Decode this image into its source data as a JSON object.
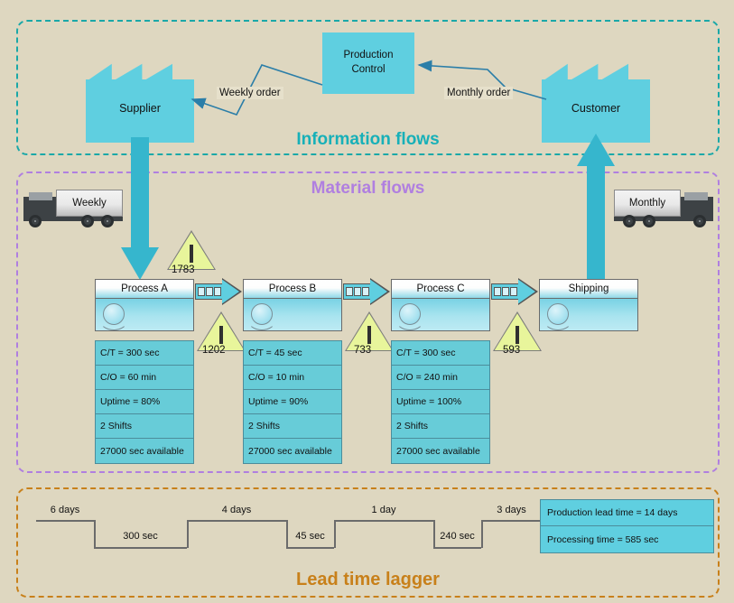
{
  "bands": {
    "information": {
      "title": "Information flows",
      "color": "#17b0b8"
    },
    "material": {
      "title": "Material flows",
      "color": "#b07fe0"
    },
    "ladder": {
      "title": "Lead time lagger",
      "color": "#c8801a"
    }
  },
  "information": {
    "supplier_label": "Supplier",
    "customer_label": "Customer",
    "production_control_label": "Production\nControl",
    "production_control_line1": "Production",
    "production_control_line2": "Control",
    "weekly_order_label": "Weekly order",
    "monthly_order_label": "Monthly order"
  },
  "material": {
    "inbound_truck_label": "Weekly",
    "outbound_truck_label": "Monthly",
    "processes": [
      {
        "name": "Process A",
        "metrics": [
          "C/T = 300 sec",
          "C/O = 60 min",
          "Uptime = 80%",
          "2 Shifts",
          "27000 sec available"
        ]
      },
      {
        "name": "Process B",
        "metrics": [
          "C/T = 45 sec",
          "C/O = 10 min",
          "Uptime = 90%",
          "2 Shifts",
          "27000 sec available"
        ]
      },
      {
        "name": "Process C",
        "metrics": [
          "C/T = 300 sec",
          "C/O = 240 min",
          "Uptime = 100%",
          "2 Shifts",
          "27000 sec available"
        ]
      },
      {
        "name": "Shipping",
        "metrics": []
      }
    ],
    "inventories": [
      {
        "symbol": "I",
        "count": "1783"
      },
      {
        "symbol": "I",
        "count": "1202"
      },
      {
        "symbol": "I",
        "count": "733"
      },
      {
        "symbol": "I",
        "count": "593"
      }
    ]
  },
  "ladder": {
    "wait_times": [
      "6 days",
      "4 days",
      "1 day",
      "3 days"
    ],
    "process_times": [
      "300 sec",
      "45 sec",
      "240 sec"
    ],
    "summary": [
      "Production lead time = 14 days",
      "Processing time = 585 sec"
    ]
  },
  "colors": {
    "background": "#ded7c0",
    "cyan": "#5fcfe0",
    "arrow_cyan": "#36b6cd",
    "inventory_yellow": "#e8f59b",
    "data_box": "#67ccd8"
  }
}
